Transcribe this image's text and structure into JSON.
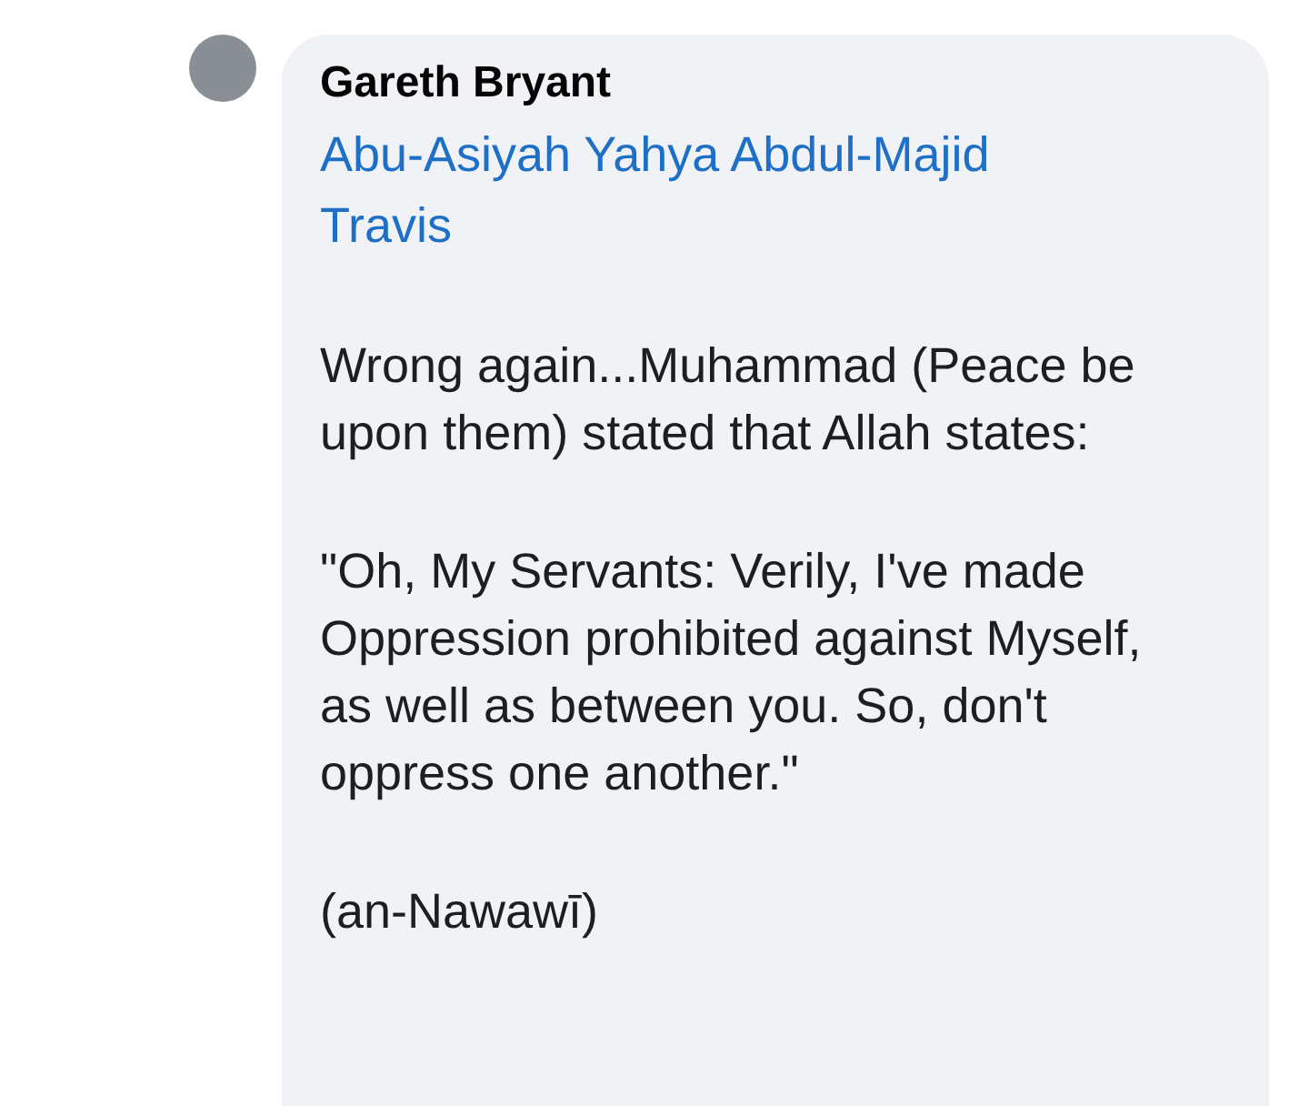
{
  "comment": {
    "author": "Gareth Bryant",
    "mention": "Abu-Asiyah Yahya Abdul-Majid Travis",
    "paragraphs": [
      "Wrong again...Muhammad (Peace be upon them) stated that Allah states:",
      "\"Oh, My Servants: Verily, I've made Oppression prohibited against Myself, as well as between you. So, don't oppress one another.\"",
      "(an-Nawawī)"
    ]
  }
}
